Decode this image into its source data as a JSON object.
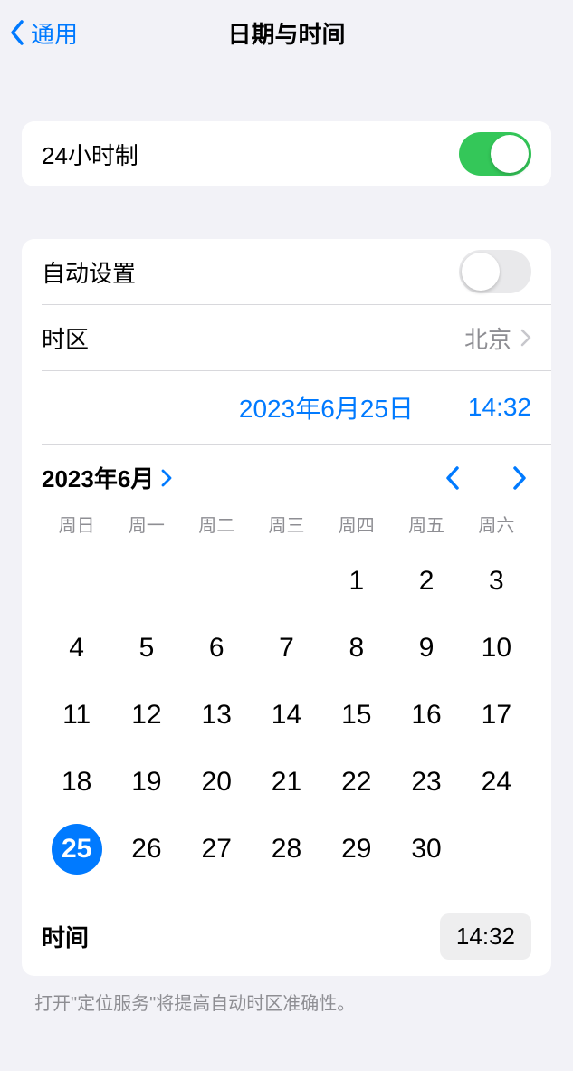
{
  "nav": {
    "back": "通用",
    "title": "日期与时间"
  },
  "twentyFourHour": {
    "label": "24小时制",
    "on": true
  },
  "autoSet": {
    "label": "自动设置",
    "on": false
  },
  "timezone": {
    "label": "时区",
    "value": "北京"
  },
  "selected": {
    "date": "2023年6月25日",
    "time": "14:32"
  },
  "calendar": {
    "monthLabel": "2023年6月",
    "weekdays": [
      "周日",
      "周一",
      "周二",
      "周三",
      "周四",
      "周五",
      "周六"
    ],
    "leadingBlanks": 4,
    "daysInMonth": 30,
    "selectedDay": 25
  },
  "timeRow": {
    "label": "时间",
    "value": "14:32"
  },
  "footer": "打开\"定位服务\"将提高自动时区准确性。"
}
